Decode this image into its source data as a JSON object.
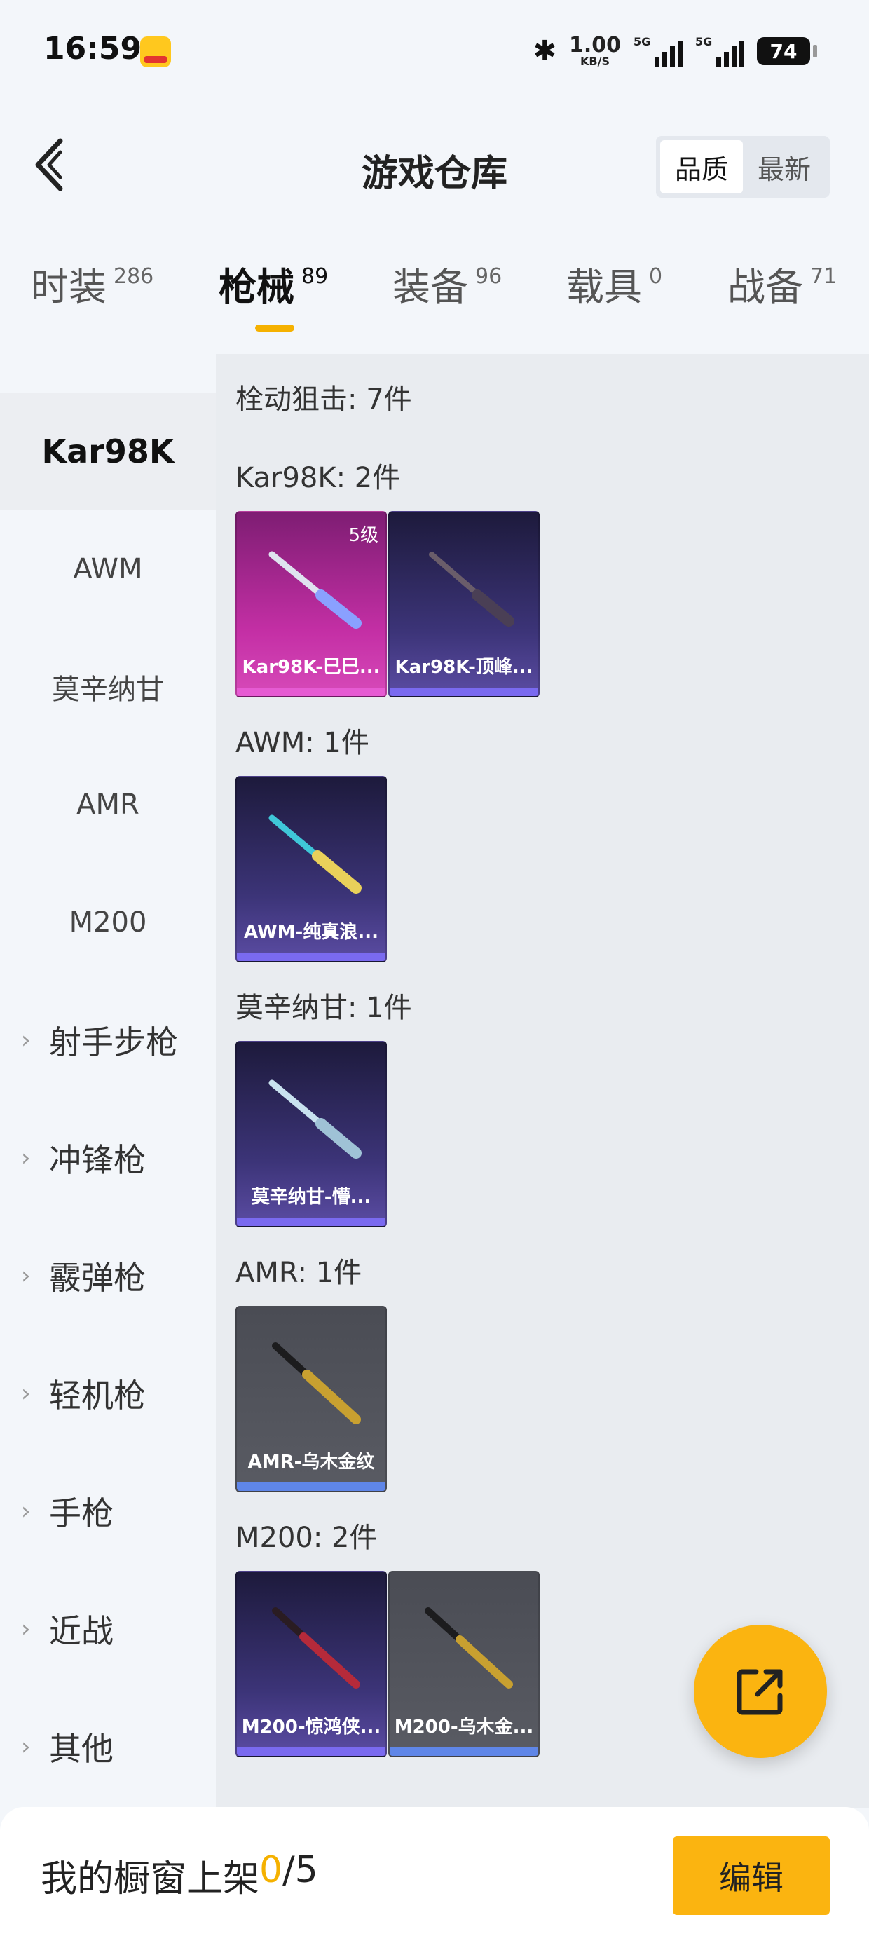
{
  "status_bar": {
    "time": "16:59",
    "net_speed": "1.00",
    "net_unit": "KB/S",
    "signal1": "5G",
    "signal2": "5G",
    "battery": "74"
  },
  "header": {
    "title": "游戏仓库",
    "sort": [
      "品质",
      "最新"
    ],
    "sort_selected": "品质"
  },
  "tabs": [
    {
      "label": "时装",
      "count": "286"
    },
    {
      "label": "枪械",
      "count": "89",
      "active": true
    },
    {
      "label": "装备",
      "count": "96"
    },
    {
      "label": "载具",
      "count": "0"
    },
    {
      "label": "战备",
      "count": "71"
    }
  ],
  "sidebar": {
    "items": [
      {
        "label": "Kar98K",
        "active": true
      },
      {
        "label": "AWM"
      },
      {
        "label": "莫辛纳甘"
      },
      {
        "label": "AMR"
      },
      {
        "label": "M200"
      },
      {
        "label": "射手步枪",
        "expandable": true
      },
      {
        "label": "冲锋枪",
        "expandable": true
      },
      {
        "label": "霰弹枪",
        "expandable": true
      },
      {
        "label": "轻机枪",
        "expandable": true
      },
      {
        "label": "手枪",
        "expandable": true
      },
      {
        "label": "近战",
        "expandable": true
      },
      {
        "label": "其他",
        "expandable": true
      }
    ]
  },
  "content": {
    "category_title": "栓动狙击: 7件",
    "sections": [
      {
        "title": "Kar98K: 2件",
        "items": [
          {
            "name": "Kar98K-巳巳...",
            "level": "5级",
            "rarity": "pink"
          },
          {
            "name": "Kar98K-顶峰...",
            "rarity": "purple"
          }
        ]
      },
      {
        "title": "AWM: 1件",
        "items": [
          {
            "name": "AWM-纯真浪...",
            "rarity": "purple"
          }
        ]
      },
      {
        "title": "莫辛纳甘: 1件",
        "items": [
          {
            "name": "莫辛纳甘-懵...",
            "rarity": "purple"
          }
        ]
      },
      {
        "title": "AMR: 1件",
        "items": [
          {
            "name": "AMR-乌木金纹",
            "rarity": "gray"
          }
        ]
      },
      {
        "title": "M200: 2件",
        "items": [
          {
            "name": "M200-惊鸿侠...",
            "rarity": "purple"
          },
          {
            "name": "M200-乌木金...",
            "rarity": "gray"
          }
        ]
      }
    ]
  },
  "bottom_bar": {
    "label": "我的橱窗上架 ",
    "count": "0",
    "total": "/5",
    "edit_label": "编辑"
  },
  "colors": {
    "accent": "#fbb410",
    "rarity_pink": "#c42fa5",
    "rarity_purple": "#3c3478",
    "rarity_gray": "#595b63"
  },
  "icons": [
    "back-arrow-icon",
    "bluetooth-icon",
    "signal-icon",
    "battery-icon",
    "chevron-right-icon",
    "share-icon",
    "rifle-icon"
  ]
}
